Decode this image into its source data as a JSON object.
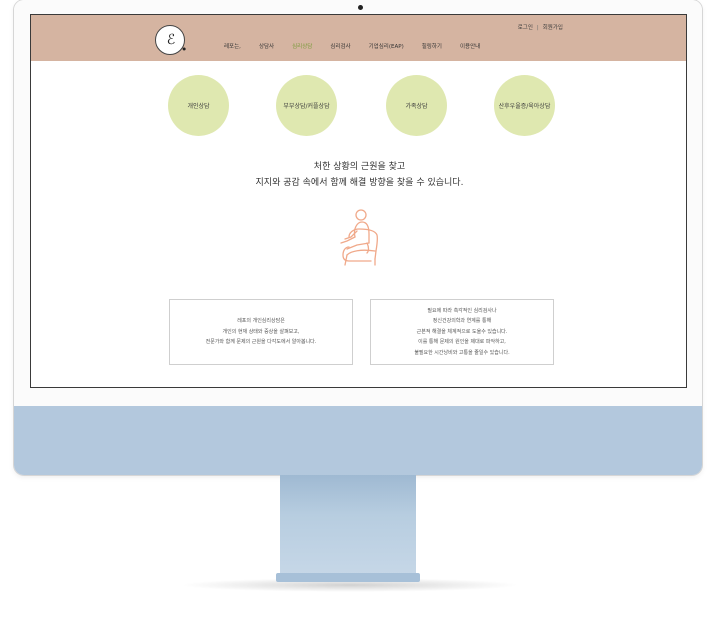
{
  "header": {
    "logo_text": "ℰ",
    "login": "로그인",
    "signup": "회원가입",
    "nav": [
      "레포는,",
      "상담사",
      "심리상담",
      "심리검사",
      "기업심리(EAP)",
      "힐링하기",
      "이용안내"
    ],
    "active_nav_index": 2
  },
  "services": [
    "개인상담",
    "부부상담/커플상담",
    "가족상담",
    "산후우울증/육아상담"
  ],
  "headline": {
    "line1": "처한 상황의 근원을 찾고",
    "line2": "지지와 공감 속에서 함께 해결 방향을 찾을 수 있습니다."
  },
  "box_left": [
    "레포의 개인심리상담은",
    "개인의 현재 상태와 증상을 살펴보고,",
    "전문가와 함께 문제의 근원을 다각도에서 알아봅니다."
  ],
  "box_right": [
    "필요에 따라 측각적인 심리검사나",
    "정신건강의학과 연계를 통해",
    "근본적 해결을 체계적으로 도울수 있습니다.",
    "이를 통해 문제의 원인을 제대로 파악하고,",
    "불필요한 시간낭비와 고통을 줄일수 있습니다."
  ],
  "colors": {
    "header_bg": "#d5b4a1",
    "circle_bg": "#dfe8b0",
    "active_nav": "#7a9a3a",
    "illustration": "#f0a98a",
    "monitor_chin": "#b3c8dd"
  },
  "icons": [
    "person-on-chair-icon"
  ]
}
